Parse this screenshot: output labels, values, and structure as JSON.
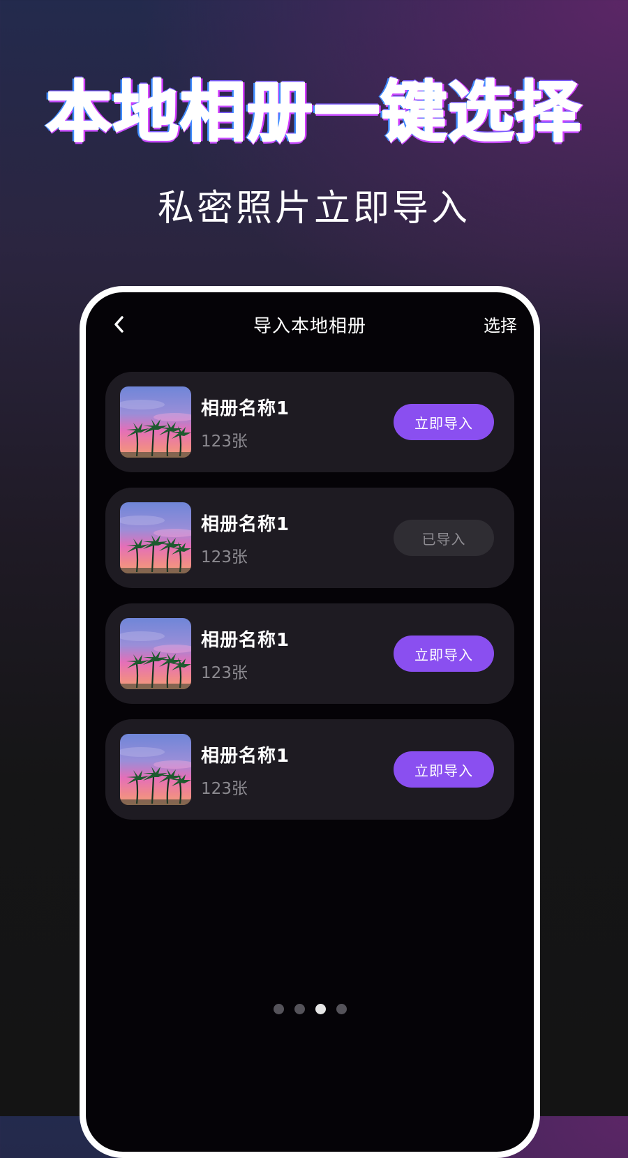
{
  "promo": {
    "title": "本地相册一键选择",
    "subtitle": "私密照片立即导入"
  },
  "nav": {
    "back_icon": "chevron-left-icon",
    "title": "导入本地相册",
    "action": "选择"
  },
  "albums": [
    {
      "name": "相册名称1",
      "count": "123张",
      "button": "立即导入",
      "imported": false
    },
    {
      "name": "相册名称1",
      "count": "123张",
      "button": "已导入",
      "imported": true
    },
    {
      "name": "相册名称1",
      "count": "123张",
      "button": "立即导入",
      "imported": false
    },
    {
      "name": "相册名称1",
      "count": "123张",
      "button": "立即导入",
      "imported": false
    }
  ],
  "pagination": {
    "total": 4,
    "active_index": 2
  },
  "colors": {
    "accent": "#8a4ff0",
    "imported_button": "#2f2d33",
    "card": "#1e1b22",
    "screen": "#050307"
  }
}
